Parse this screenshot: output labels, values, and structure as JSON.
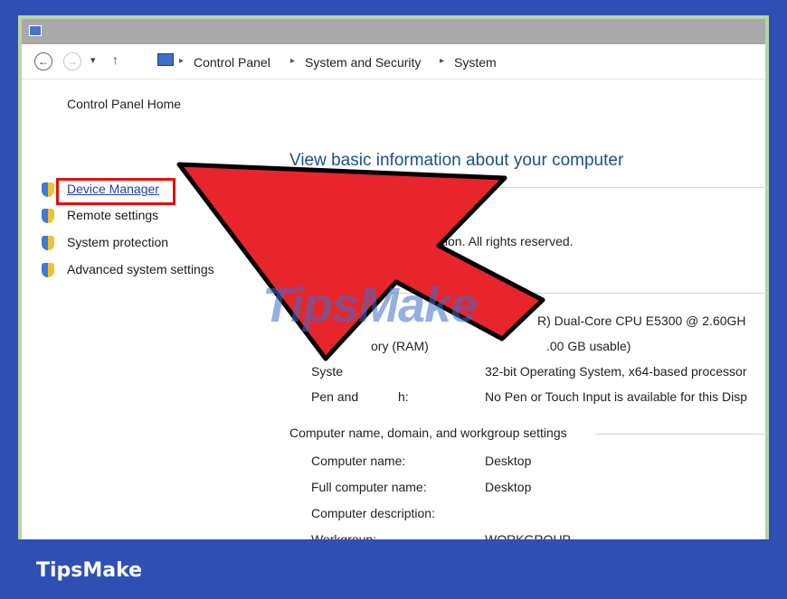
{
  "address_bar": {
    "breadcrumb": [
      "Control Panel",
      "System and Security",
      "System"
    ]
  },
  "left_nav": {
    "home_link": "Control Panel Home",
    "tasks": [
      "Device Manager",
      "Remote settings",
      "System protection",
      "Advanced system settings"
    ]
  },
  "main": {
    "title": "View basic information about your computer",
    "copyright_text": "poration. All rights reserved.",
    "system": {
      "processor_value": "R) Dual-Core  CPU     E5300  @ 2.60GH",
      "memory_label": "ory (RAM)",
      "memory_value": ".00 GB usable)",
      "system_type_label": "Syste",
      "system_type_value": "32-bit Operating System, x64-based processor",
      "pen_label": "Pen and",
      "pen_label_tail": "h:",
      "pen_value": "No Pen or Touch Input is available for this Disp"
    },
    "computer_name_section": {
      "header": "Computer name, domain, and workgroup settings",
      "rows": [
        {
          "label": "Computer name:",
          "value": "Desktop"
        },
        {
          "label": "Full computer name:",
          "value": "Desktop"
        },
        {
          "label": "Computer description:",
          "value": ""
        },
        {
          "label": "Workgroup:",
          "value": "WORKGROUP"
        }
      ]
    }
  },
  "overlay": {
    "watermark": "TipsMake",
    "arrow_color": "#e8252b",
    "highlight_color": "#e01010"
  },
  "footer": {
    "brand": "TipsMake",
    "background": "#2f4fb5"
  }
}
